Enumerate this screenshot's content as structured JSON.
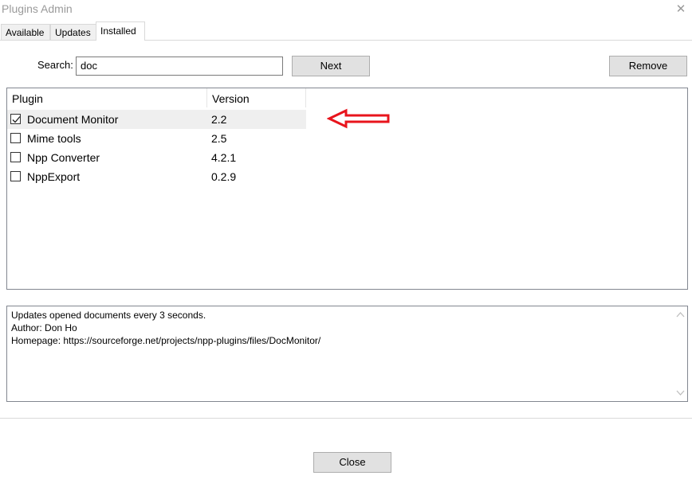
{
  "window": {
    "title": "Plugins Admin",
    "close_glyph": "✕"
  },
  "tabs": [
    {
      "label": "Available",
      "active": false
    },
    {
      "label": "Updates",
      "active": false
    },
    {
      "label": "Installed",
      "active": true
    }
  ],
  "search": {
    "label": "Search:",
    "value": "doc"
  },
  "buttons": {
    "next": "Next",
    "remove": "Remove",
    "close": "Close"
  },
  "plugin_list": {
    "columns": [
      "Plugin",
      "Version"
    ],
    "rows": [
      {
        "name": "Document Monitor",
        "version": "2.2",
        "checked": true,
        "selected": true
      },
      {
        "name": "Mime tools",
        "version": "2.5",
        "checked": false,
        "selected": false
      },
      {
        "name": "Npp Converter",
        "version": "4.2.1",
        "checked": false,
        "selected": false
      },
      {
        "name": "NppExport",
        "version": "0.2.9",
        "checked": false,
        "selected": false
      }
    ]
  },
  "annotation": {
    "arrow_color": "#e8141c",
    "points_to": "Document Monitor"
  },
  "description": {
    "lines": [
      "Updates opened documents every 3 seconds.",
      "Author: Don Ho",
      "Homepage: https://sourceforge.net/projects/npp-plugins/files/DocMonitor/"
    ]
  }
}
